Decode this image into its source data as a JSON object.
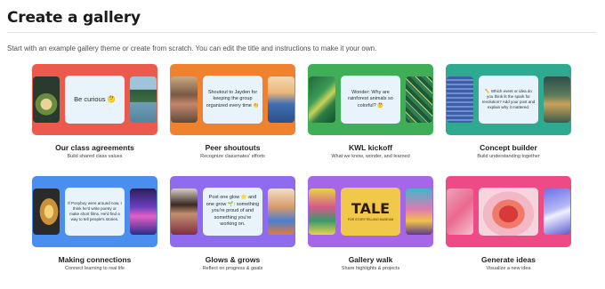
{
  "page": {
    "title": "Create a gallery",
    "intro": "Start with an example gallery theme or create from scratch. You can edit the title and instructions to make it your own."
  },
  "cards": [
    {
      "title": "Our class agreements",
      "subtitle": "Build shared class values",
      "bubble": "Be curious 🤔",
      "left_image": "plant-sprout-image",
      "right_image": "forest-lake-image",
      "color": "#ec5a4d"
    },
    {
      "title": "Peer shoutouts",
      "subtitle": "Recognize classmates' efforts",
      "bubble": "Shoutout to Jayden for keeping the group organized every time 👏",
      "left_image": "students-group-image",
      "right_image": "student-illustration-image",
      "color": "#f0812f"
    },
    {
      "title": "KWL kickoff",
      "subtitle": "What we know, wonder, and learned",
      "bubble": "Wonder: Why are rainforest animals so colorful? 🤔",
      "left_image": "rainforest-leaves-image",
      "right_image": "green-pattern-image",
      "color": "#3fae57"
    },
    {
      "title": "Concept builder",
      "subtitle": "Build understanding together",
      "bubble": "✏️ Which event or idea do you think lit the spark for revolution? Add your post and explain why it mattered.",
      "left_image": "historical-document-image",
      "right_image": "landscape-painting-image",
      "color": "#2fa98f"
    },
    {
      "title": "Making connections",
      "subtitle": "Connect learning to real life",
      "bubble": "If Ponyboy were around now, I think he'd write poetry or make short films. He'd find a way to tell people's stories.",
      "left_image": "golden-feather-image",
      "right_image": "neon-city-image",
      "color": "#4a8ef0"
    },
    {
      "title": "Glows & grows",
      "subtitle": "Reflect on progress & goals",
      "bubble": "Post one glow 🌟 and one grow 🌱: something you're proud of and something you're working on.",
      "left_image": "student-portrait-image",
      "right_image": "cartoon-students-image",
      "color": "#8f6bf0"
    },
    {
      "title": "Gallery walk",
      "subtitle": "Share highlights & projects",
      "bubble": "TALE",
      "bubble_sub": "FOR STORYTELLING MUSEUM",
      "left_image": "book-cover-image",
      "right_image": "poster-art-image",
      "color": "#a567e8"
    },
    {
      "title": "Generate ideas",
      "subtitle": "Visualize a new idea",
      "left_image": "betta-fish-image",
      "right_image": "futuristic-car-image",
      "color": "#ee4b86"
    }
  ]
}
